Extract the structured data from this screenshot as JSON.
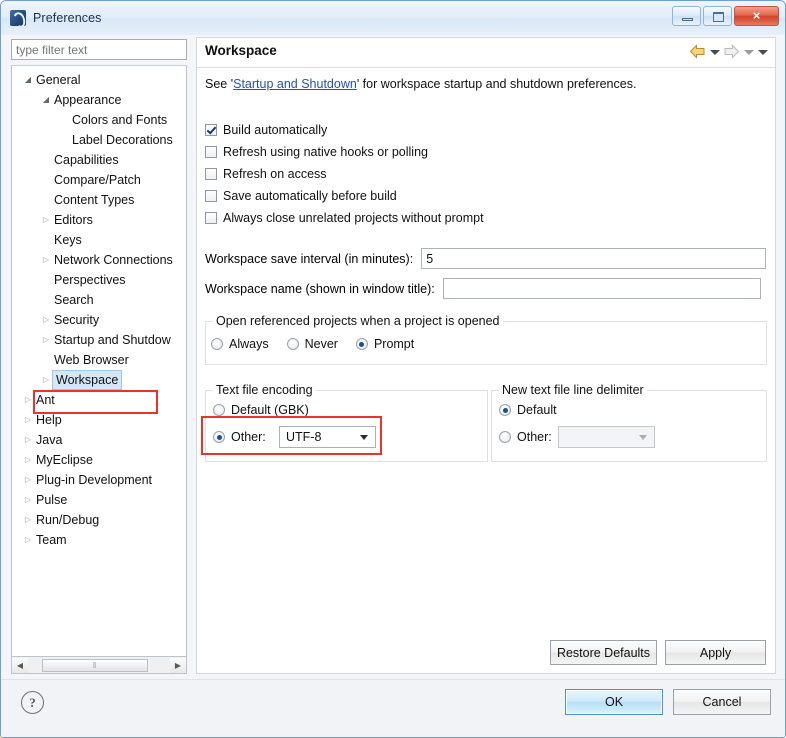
{
  "window": {
    "title": "Preferences",
    "app_icon": "eclipse-icon",
    "minimize_label": "Minimize",
    "maximize_label": "Maximize",
    "close_label": "×"
  },
  "sidebar": {
    "filter_placeholder": "type filter text",
    "filter_value": "",
    "scroll_left_glyph": "◀",
    "scroll_right_glyph": "▶",
    "thumb_grip": "‖",
    "items": [
      {
        "label": "General",
        "indent": 0,
        "state": "expanded"
      },
      {
        "label": "Appearance",
        "indent": 1,
        "state": "expanded"
      },
      {
        "label": "Colors and Fonts",
        "indent": 2,
        "state": "leaf"
      },
      {
        "label": "Label Decorations",
        "indent": 2,
        "state": "leaf"
      },
      {
        "label": "Capabilities",
        "indent": 1,
        "state": "leaf"
      },
      {
        "label": "Compare/Patch",
        "indent": 1,
        "state": "leaf"
      },
      {
        "label": "Content Types",
        "indent": 1,
        "state": "leaf"
      },
      {
        "label": "Editors",
        "indent": 1,
        "state": "collapsed"
      },
      {
        "label": "Keys",
        "indent": 1,
        "state": "leaf"
      },
      {
        "label": "Network Connections",
        "indent": 1,
        "state": "collapsed"
      },
      {
        "label": "Perspectives",
        "indent": 1,
        "state": "leaf"
      },
      {
        "label": "Search",
        "indent": 1,
        "state": "leaf"
      },
      {
        "label": "Security",
        "indent": 1,
        "state": "collapsed"
      },
      {
        "label": "Startup and Shutdow",
        "indent": 1,
        "state": "collapsed"
      },
      {
        "label": "Web Browser",
        "indent": 1,
        "state": "leaf"
      },
      {
        "label": "Workspace",
        "indent": 1,
        "state": "collapsed",
        "selected": true
      },
      {
        "label": "Ant",
        "indent": 0,
        "state": "collapsed"
      },
      {
        "label": "Help",
        "indent": 0,
        "state": "collapsed"
      },
      {
        "label": "Java",
        "indent": 0,
        "state": "collapsed"
      },
      {
        "label": "MyEclipse",
        "indent": 0,
        "state": "collapsed"
      },
      {
        "label": "Plug-in Development",
        "indent": 0,
        "state": "collapsed"
      },
      {
        "label": "Pulse",
        "indent": 0,
        "state": "collapsed"
      },
      {
        "label": "Run/Debug",
        "indent": 0,
        "state": "collapsed"
      },
      {
        "label": "Team",
        "indent": 0,
        "state": "collapsed"
      }
    ]
  },
  "page": {
    "title": "Workspace",
    "nav": {
      "back_icon": "back-arrow-icon",
      "back_menu_icon": "chevron-down-icon",
      "forward_icon": "forward-arrow-icon",
      "forward_menu_icon": "chevron-down-icon",
      "view_menu_icon": "chevron-down-icon"
    },
    "intro": {
      "prefix": "See ",
      "link_open_quote": "'",
      "link": "Startup and Shutdown",
      "link_close_quote": "'",
      "suffix": " for workspace startup and shutdown preferences."
    },
    "checkboxes": [
      {
        "label": "Build automatically",
        "checked": true
      },
      {
        "label": "Refresh using native hooks or polling",
        "checked": false
      },
      {
        "label": "Refresh on access",
        "checked": false
      },
      {
        "label": "Save automatically before build",
        "checked": false
      },
      {
        "label": "Always close unrelated projects without prompt",
        "checked": false
      }
    ],
    "save_interval": {
      "label": "Workspace save interval (in minutes):",
      "value": "5"
    },
    "workspace_name": {
      "label": "Workspace name (shown in window title):",
      "value": ""
    },
    "open_referenced": {
      "legend": "Open referenced projects when a project is opened",
      "options": [
        {
          "label": "Always",
          "selected": false
        },
        {
          "label": "Never",
          "selected": false
        },
        {
          "label": "Prompt",
          "selected": true
        }
      ]
    },
    "text_file_encoding": {
      "legend": "Text file encoding",
      "default_label": "Default (GBK)",
      "default_selected": false,
      "other_label": "Other:",
      "other_selected": true,
      "other_value": "UTF-8"
    },
    "line_delimiter": {
      "legend": "New text file line delimiter",
      "default_label": "Default",
      "default_selected": true,
      "other_label": "Other:",
      "other_selected": false,
      "other_value": ""
    },
    "restore_defaults_label": "Restore Defaults",
    "apply_label": "Apply"
  },
  "footer": {
    "help_glyph": "?",
    "ok_label": "OK",
    "cancel_label": "Cancel"
  }
}
